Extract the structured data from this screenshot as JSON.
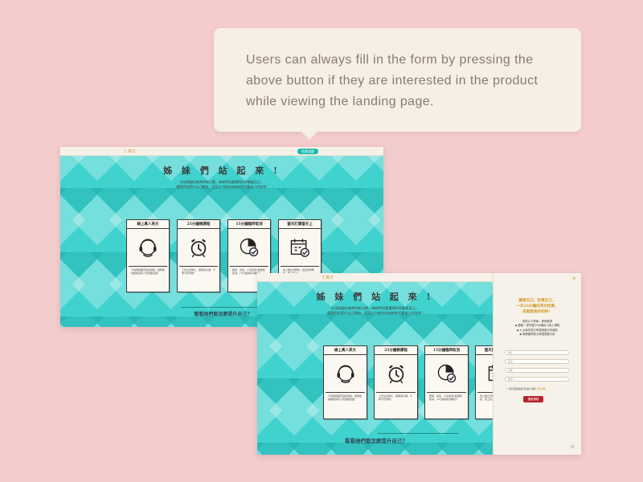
{
  "tooltip": {
    "text": "Users can always fill in the form by pressing the above button if they are interested in the product while viewing the landing page."
  },
  "landing": {
    "logo": "Ｅ英文",
    "cta_button": "免費試聽",
    "title": "姊 妹 們 站 起 來 !",
    "subtitle_line1": "在這個變幻無常的新日裡，姊妹們也要懂得好好寵愛自己，",
    "subtitle_line2": "讓我們從提升自己開始，用英文力助你成為新時代最迷人的女性!",
    "bottom_text": "看看她們都怎麼提升自己?",
    "cards": [
      {
        "title": "線上真人英文",
        "icon": "headset-icon",
        "desc": "不用再跑補習班和通勤，隨時隨地都能與真人老師面對面！"
      },
      {
        "title": "25分鐘微課程",
        "icon": "alarm-clock-icon",
        "desc": "工作生活繁忙，隨時英文課，不再不知何時！"
      },
      {
        "title": "15分鐘臨時取消",
        "icon": "clock-check-icon",
        "desc": "臨時、加班、小孩突發?能隨時取消，15分鐘前取消都可！"
      },
      {
        "title": "當天訂課當天上",
        "icon": "calendar-check-icon",
        "desc": "想上課立刻預約，彈性安排時間，想上就上！"
      }
    ]
  },
  "side_panel": {
    "close": "✕",
    "title_line1": "寵愛自己，投資自己，",
    "title_line2": "一天25分鐘的英文投資，",
    "title_line3": "成就更美好的妳！",
    "sub_line1": "填寫以下表單，即時獲得",
    "sub_line2": "◆ 體驗一堂完整25分鐘真人線上課程",
    "sub_line3": "◆ 九大面向英文學習程度分析報告",
    "sub_line4": "◆ 專業顧問英文學習規劃分析",
    "fields": [
      "姓名",
      "電話",
      "信箱",
      "推薦人"
    ],
    "agree_text": "我已經閱讀並同意個人資料",
    "agree_link": "蒐集說明",
    "submit": "獲取課程"
  },
  "colors": {
    "background": "#f4ccce",
    "tooltip_bg": "#f5efe6",
    "teal": "#3fd2cf",
    "cta": "#17b8b0",
    "submit": "#b8232f",
    "gold": "#d19a2a"
  }
}
